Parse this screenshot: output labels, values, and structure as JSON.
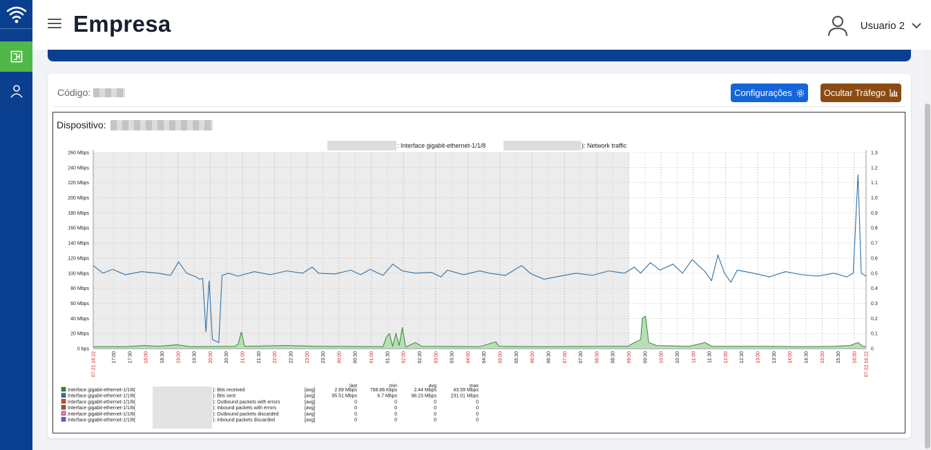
{
  "header": {
    "title": "Empresa",
    "user_name": "Usuario 2"
  },
  "card": {
    "codigo_label": "Código:",
    "config_button": "Configurações",
    "traffic_button": "Ocultar Tráfego",
    "device_label": "Dispositivo:"
  },
  "colors": {
    "sidebar": "#0a3f8f",
    "active": "#4fb848",
    "config_btn": "#1565d8",
    "traffic_btn": "#8a4b13",
    "series_received": "#2e8b2e",
    "series_sent": "#2f6fa3"
  },
  "chart_data": {
    "type": "line",
    "title_mid": ": Interface gigabit-ethernet-1/1/8",
    "title_end": "): Network traffic",
    "y_left_labels": [
      "0 bps",
      "20 Mbps",
      "40 Mbps",
      "60 Mbps",
      "80 Mbps",
      "100 Mbps",
      "120 Mbps",
      "140 Mbps",
      "160 Mbps",
      "180 Mbps",
      "200 Mbps",
      "220 Mbps",
      "240 Mbps",
      "260 Mbps"
    ],
    "y_right_labels": [
      "0",
      "0.1",
      "0.2",
      "0.3",
      "0.4",
      "0.5",
      "0.6",
      "0.7",
      "0.8",
      "0.9",
      "1.0",
      "1.1",
      "1.2",
      "1.3"
    ],
    "ylim": [
      0,
      260
    ],
    "x_labels": [
      "07-21 16:22",
      "17:00",
      "17:30",
      "18:00",
      "18:30",
      "19:00",
      "19:30",
      "20:00",
      "20:30",
      "21:00",
      "21:30",
      "22:00",
      "22:30",
      "23:00",
      "23:30",
      "00:00",
      "00:30",
      "01:00",
      "01:30",
      "02:00",
      "02:30",
      "03:00",
      "03:30",
      "04:00",
      "04:30",
      "05:00",
      "05:30",
      "06:00",
      "06:30",
      "07:00",
      "07:30",
      "08:00",
      "08:30",
      "09:00",
      "09:30",
      "10:00",
      "10:30",
      "11:00",
      "11:30",
      "12:00",
      "12:30",
      "13:00",
      "13:30",
      "14:00",
      "14:30",
      "15:00",
      "15:30",
      "16:00",
      "07-22 16:22"
    ],
    "x_labels_red": [
      "07-21 16:22",
      "18:00",
      "19:00",
      "20:00",
      "21:00",
      "22:00",
      "23:00",
      "00:00",
      "01:00",
      "02:00",
      "03:00",
      "04:00",
      "05:00",
      "06:00",
      "07:00",
      "08:00",
      "09:00",
      "10:00",
      "11:00",
      "12:00",
      "13:00",
      "14:00",
      "15:00",
      "16:00",
      "07-22 16:22"
    ],
    "x_range_hours": [
      0,
      24
    ],
    "shaded_until_hours": 16.63,
    "series_sent": {
      "name": "Bits sent",
      "points": [
        [
          0,
          110
        ],
        [
          0.3,
          100
        ],
        [
          0.6,
          105
        ],
        [
          1.0,
          98
        ],
        [
          1.5,
          102
        ],
        [
          2.0,
          100
        ],
        [
          2.4,
          97
        ],
        [
          2.65,
          115
        ],
        [
          2.9,
          100
        ],
        [
          3.2,
          95
        ],
        [
          3.3,
          92
        ],
        [
          3.4,
          93
        ],
        [
          3.5,
          22
        ],
        [
          3.6,
          90
        ],
        [
          3.7,
          12
        ],
        [
          3.8,
          10
        ],
        [
          3.9,
          8
        ],
        [
          4.0,
          97
        ],
        [
          4.2,
          100
        ],
        [
          4.5,
          96
        ],
        [
          5.0,
          102
        ],
        [
          5.5,
          98
        ],
        [
          6.0,
          103
        ],
        [
          6.5,
          100
        ],
        [
          6.8,
          108
        ],
        [
          7.0,
          100
        ],
        [
          7.5,
          99
        ],
        [
          8.0,
          104
        ],
        [
          8.3,
          98
        ],
        [
          8.6,
          105
        ],
        [
          9.0,
          97
        ],
        [
          9.3,
          112
        ],
        [
          9.6,
          103
        ],
        [
          10.0,
          100
        ],
        [
          10.5,
          101
        ],
        [
          10.8,
          95
        ],
        [
          11.0,
          104
        ],
        [
          11.5,
          98
        ],
        [
          12.0,
          103
        ],
        [
          12.3,
          100
        ],
        [
          12.8,
          97
        ],
        [
          13.3,
          110
        ],
        [
          13.6,
          99
        ],
        [
          14.0,
          92
        ],
        [
          14.5,
          96
        ],
        [
          15.0,
          100
        ],
        [
          15.5,
          97
        ],
        [
          16.0,
          103
        ],
        [
          16.5,
          100
        ],
        [
          16.8,
          108
        ],
        [
          17.0,
          100
        ],
        [
          17.3,
          114
        ],
        [
          17.6,
          104
        ],
        [
          18.0,
          112
        ],
        [
          18.3,
          100
        ],
        [
          18.6,
          118
        ],
        [
          19.0,
          102
        ],
        [
          19.2,
          90
        ],
        [
          19.4,
          124
        ],
        [
          19.6,
          100
        ],
        [
          19.8,
          88
        ],
        [
          20.0,
          104
        ],
        [
          20.5,
          100
        ],
        [
          21.0,
          95
        ],
        [
          21.5,
          102
        ],
        [
          22.0,
          98
        ],
        [
          22.5,
          96
        ],
        [
          23.0,
          100
        ],
        [
          23.4,
          95
        ],
        [
          23.6,
          100
        ],
        [
          23.75,
          231
        ],
        [
          23.85,
          100
        ],
        [
          24.0,
          96
        ]
      ]
    },
    "series_received": {
      "name": "Bits received",
      "points": [
        [
          0,
          2.5
        ],
        [
          1,
          2.6
        ],
        [
          1.6,
          4
        ],
        [
          2,
          3
        ],
        [
          2.6,
          5
        ],
        [
          3,
          2.5
        ],
        [
          4.4,
          3
        ],
        [
          4.5,
          6
        ],
        [
          4.6,
          22
        ],
        [
          4.7,
          3
        ],
        [
          6,
          4
        ],
        [
          7,
          3
        ],
        [
          9,
          2.5
        ],
        [
          9.1,
          15
        ],
        [
          9.2,
          20
        ],
        [
          9.3,
          3
        ],
        [
          9.4,
          20
        ],
        [
          9.5,
          4
        ],
        [
          9.6,
          28
        ],
        [
          9.7,
          2
        ],
        [
          10,
          8
        ],
        [
          10.2,
          3
        ],
        [
          12,
          2.5
        ],
        [
          12.5,
          9
        ],
        [
          12.6,
          3
        ],
        [
          14,
          2.5
        ],
        [
          16,
          3
        ],
        [
          16.6,
          3
        ],
        [
          16.8,
          8
        ],
        [
          17,
          12
        ],
        [
          17.05,
          40
        ],
        [
          17.15,
          43
        ],
        [
          17.25,
          8
        ],
        [
          17.5,
          4
        ],
        [
          18.5,
          3
        ],
        [
          19.0,
          8
        ],
        [
          19.2,
          3
        ],
        [
          21,
          3
        ],
        [
          22,
          2.5
        ],
        [
          23,
          3
        ],
        [
          23.5,
          4
        ],
        [
          23.75,
          8
        ],
        [
          23.9,
          3
        ],
        [
          24,
          2.5
        ]
      ]
    },
    "legend": [
      {
        "color": "#2e8b2e",
        "label": "Interface gigabit-ethernet-1/1/8(",
        "suffix": "): Bits received",
        "agg": "[avg]",
        "last": "2.69 Mbps",
        "min": "768.86 Kbps",
        "avg": "2.44 Mbps",
        "max": "43.59 Mbps"
      },
      {
        "color": "#2f6fa3",
        "label": "Interface gigabit-ethernet-1/1/8(",
        "suffix": "): Bits sent",
        "agg": "[avg]",
        "last": "95.51 Mbps",
        "min": "6.7 Mbps",
        "avg": "98.23 Mbps",
        "max": "231.01 Mbps"
      },
      {
        "color": "#d4442f",
        "label": "Interface gigabit-ethernet-1/1/8(",
        "suffix": "): Outbound packets with errors",
        "agg": "[avg]",
        "last": "0",
        "min": "0",
        "avg": "0",
        "max": "0"
      },
      {
        "color": "#a0522d",
        "label": "Interface gigabit-ethernet-1/1/8(",
        "suffix": "): Inbound packets with errors",
        "agg": "[avg]",
        "last": "0",
        "min": "0",
        "avg": "0",
        "max": "0"
      },
      {
        "color": "#e87aa0",
        "label": "Interface gigabit-ethernet-1/1/8(",
        "suffix": "): Outbound packets discarded",
        "agg": "[avg]",
        "last": "0",
        "min": "0",
        "avg": "0",
        "max": "0"
      },
      {
        "color": "#6a5acd",
        "label": "Interface gigabit-ethernet-1/1/8(",
        "suffix": "): Inbound packets discarded",
        "agg": "[avg]",
        "last": "0",
        "min": "0",
        "avg": "0",
        "max": "0"
      }
    ],
    "legend_headers": [
      "last",
      "min",
      "avg",
      "max"
    ]
  }
}
